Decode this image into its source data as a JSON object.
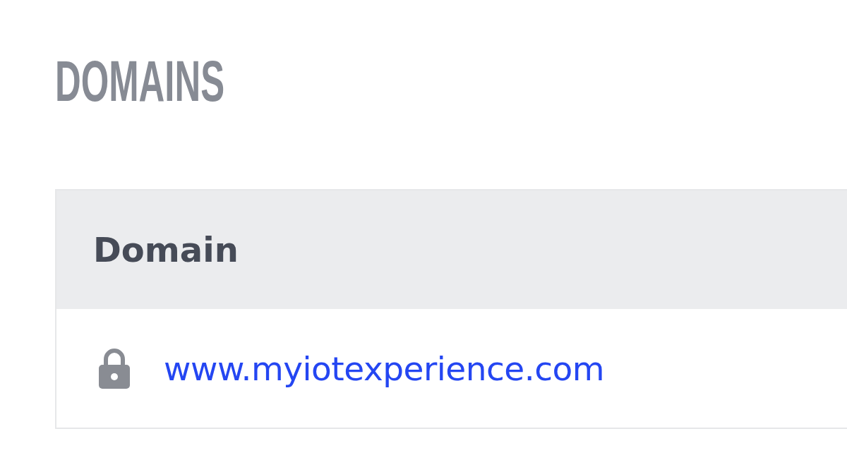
{
  "heading": "DOMAINS",
  "table": {
    "columns": [
      "Domain"
    ],
    "rows": [
      {
        "domain": "www.myiotexperience.com",
        "locked": true
      }
    ]
  }
}
